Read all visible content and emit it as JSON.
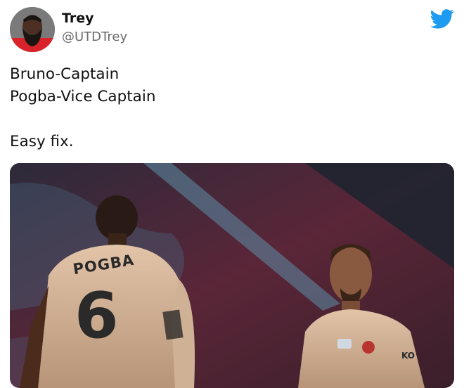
{
  "tweet": {
    "author": {
      "display_name": "Trey",
      "handle": "@UTDTrey"
    },
    "text_lines": [
      "Bruno-Captain",
      "Pogba-Vice Captain",
      "",
      "Easy fix."
    ],
    "media": {
      "jersey_name": "POGBA",
      "jersey_number": "6",
      "sponsor_text": "KO"
    },
    "icons": {
      "avatar": "avatar",
      "brand": "twitter-bird-icon"
    },
    "colors": {
      "twitter_blue": "#1d9bf0",
      "handle_gray": "#6b6b6b"
    }
  }
}
